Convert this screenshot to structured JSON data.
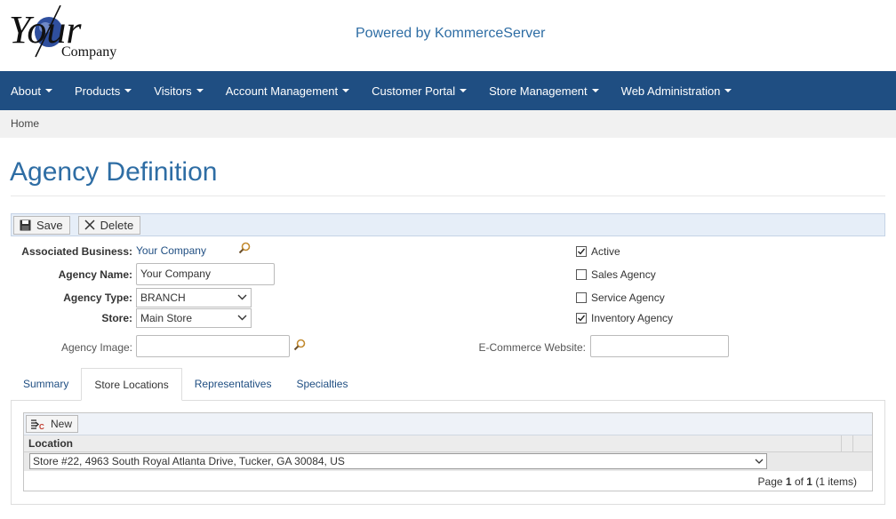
{
  "header": {
    "logo_text_main": "Your",
    "logo_text_sub": "Company",
    "powered_by": "Powered by KommerceServer"
  },
  "navbar": {
    "items": [
      {
        "label": "About"
      },
      {
        "label": "Products"
      },
      {
        "label": "Visitors"
      },
      {
        "label": "Account Management"
      },
      {
        "label": "Customer Portal"
      },
      {
        "label": "Store Management"
      },
      {
        "label": "Web Administration"
      }
    ]
  },
  "breadcrumb": {
    "home": "Home"
  },
  "page": {
    "title": "Agency Definition"
  },
  "toolbar": {
    "save_label": "Save",
    "delete_label": "Delete"
  },
  "form": {
    "associated_business_label": "Associated Business:",
    "associated_business_value": "Your Company",
    "agency_name_label": "Agency Name:",
    "agency_name_value": "Your Company",
    "agency_type_label": "Agency Type:",
    "agency_type_value": "BRANCH",
    "store_label": "Store:",
    "store_value": "Main Store",
    "agency_image_label": "Agency Image:",
    "agency_image_value": "",
    "ecommerce_label": "E-Commerce Website:",
    "ecommerce_value": ""
  },
  "checkboxes": [
    {
      "label": "Active",
      "checked": true
    },
    {
      "label": "Sales Agency",
      "checked": false
    },
    {
      "label": "Service Agency",
      "checked": false
    },
    {
      "label": "Inventory Agency",
      "checked": true
    }
  ],
  "tabs": [
    {
      "label": "Summary",
      "active": false
    },
    {
      "label": "Store Locations",
      "active": true
    },
    {
      "label": "Representatives",
      "active": false
    },
    {
      "label": "Specialties",
      "active": false
    }
  ],
  "grid": {
    "new_label": "New",
    "column_location": "Location",
    "rows": [
      {
        "location": "Store #22, 4963 South Royal Atlanta Drive, Tucker, GA 30084, US"
      }
    ],
    "pager": {
      "prefix": "Page",
      "current": "1",
      "of": "of",
      "total": "1",
      "items": "(1 items)"
    }
  },
  "colors": {
    "navbar": "#1f4e82",
    "title": "#2e6da4",
    "link": "#1f4e82"
  }
}
